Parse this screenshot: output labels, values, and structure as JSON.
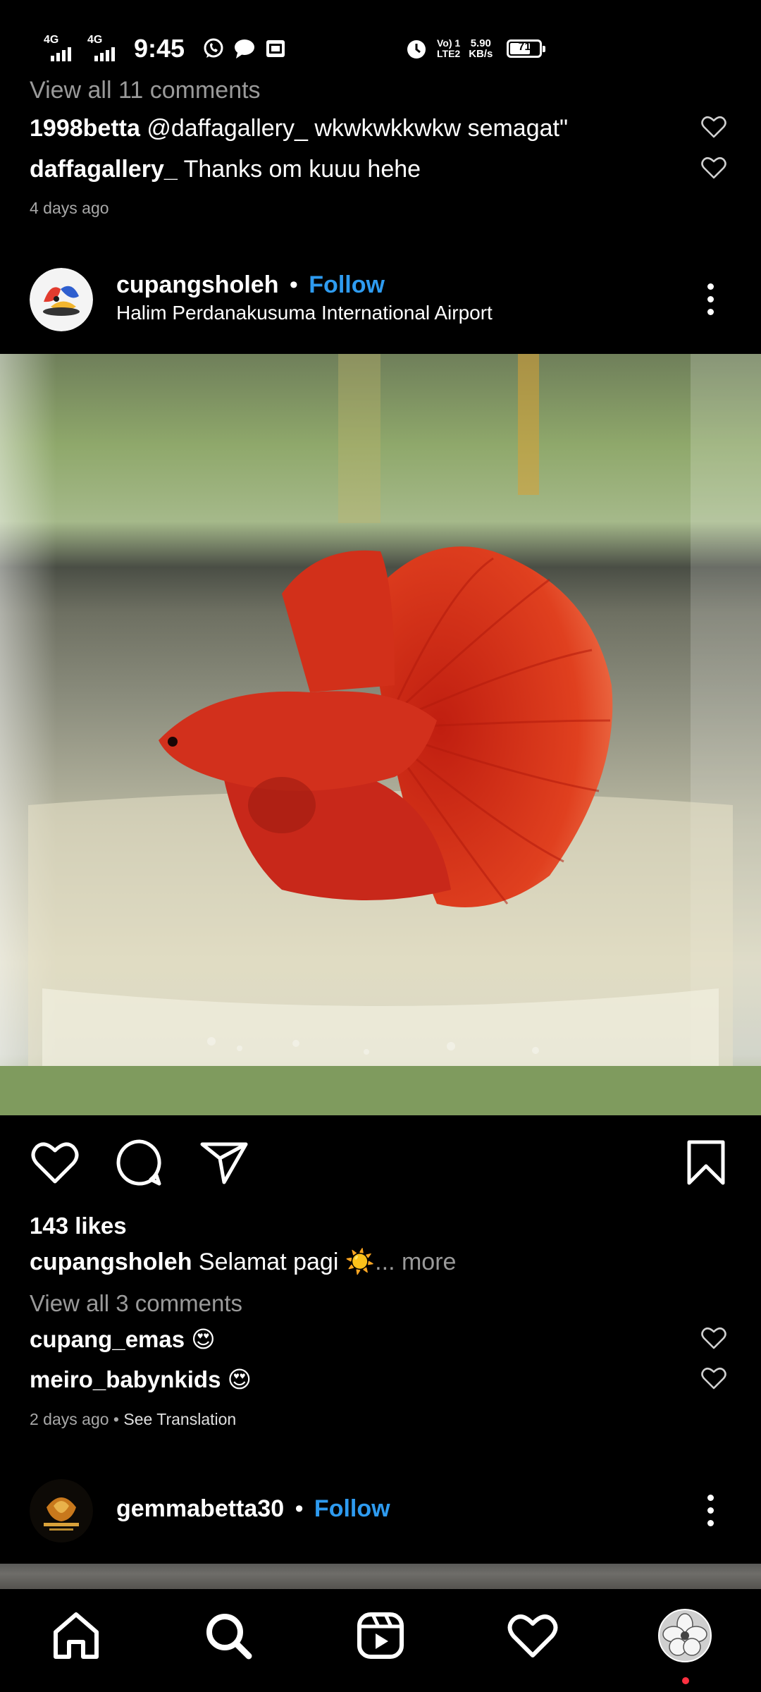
{
  "status_bar": {
    "net1": "4G",
    "net2": "4G",
    "time": "9:45",
    "volte_line1": "Vo) 1",
    "volte_line2": "LTE2",
    "speed_value": "5.90",
    "speed_unit": "KB/s",
    "battery": "71",
    "battery_level": 0.71
  },
  "prev_post": {
    "view_all": "View all 11 comments",
    "comments": [
      {
        "user": "1998betta",
        "text": "@daffagallery_ wkwkwkkwkw semagat\""
      },
      {
        "user": "daffagallery_",
        "text": "Thanks om kuuu hehe"
      }
    ],
    "time": "4 days ago"
  },
  "post": {
    "username": "cupangsholeh",
    "separator": "•",
    "follow": "Follow",
    "location": "Halim Perdanakusuma International Airport",
    "likes": "143 likes",
    "caption_user": "cupangsholeh",
    "caption_text": "Selamat pagi ☀️",
    "caption_more": "... more",
    "view_all": "View all 3 comments",
    "comments": [
      {
        "user": "cupang_emas",
        "text": "😍"
      },
      {
        "user": "meiro_babynkids",
        "text": "😍"
      }
    ],
    "time": "2 days ago",
    "time_sep": " • ",
    "see_translation": "See Translation"
  },
  "next_post": {
    "username": "gemmabetta30",
    "separator": "•",
    "follow": "Follow"
  },
  "icons": {
    "status": [
      "whatsapp-icon",
      "message-icon",
      "gallery-icon",
      "alarm-icon"
    ],
    "actions": [
      "heart-icon",
      "comment-icon",
      "share-icon",
      "bookmark-icon"
    ],
    "nav": [
      "home-icon",
      "search-icon",
      "reels-icon",
      "activity-heart-icon",
      "profile-avatar"
    ]
  },
  "colors": {
    "background": "#000000",
    "follow_blue": "#2e9bf0",
    "muted_text": "#9a9a9a",
    "notification_dot": "#ff3040",
    "fish_red": "#d9301c"
  }
}
